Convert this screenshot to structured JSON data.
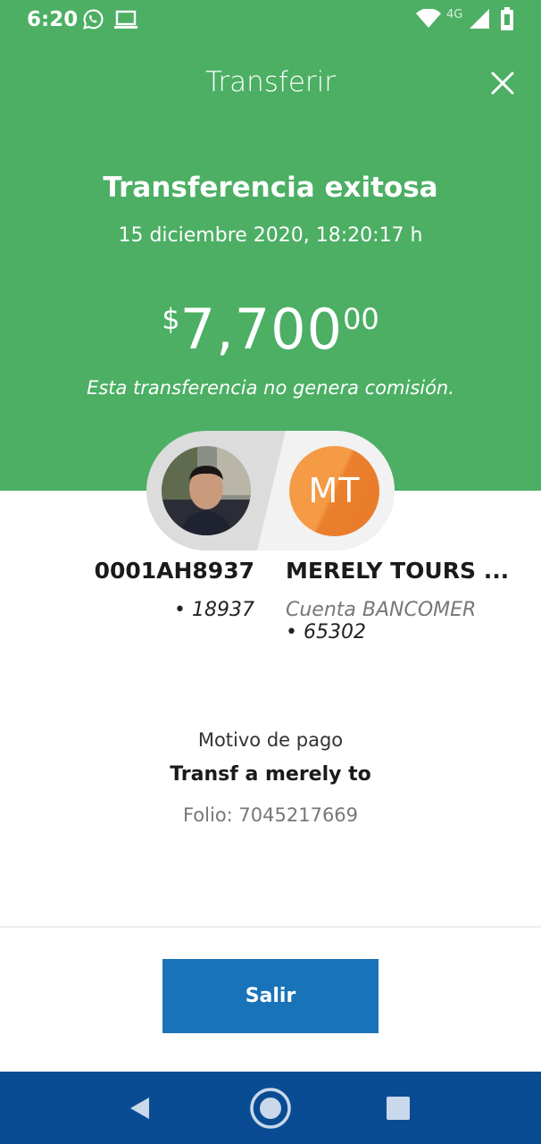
{
  "status_bar": {
    "time": "6:20",
    "network": "4G",
    "icons": [
      "whatsapp-icon",
      "laptop-icon",
      "wifi-icon",
      "signal-icon",
      "battery-icon"
    ]
  },
  "header": {
    "title": "Transferir",
    "close_icon": "close-icon"
  },
  "result": {
    "title": "Transferencia exitosa",
    "datetime": "15 diciembre 2020, 18:20:17 h",
    "amount_currency": "$",
    "amount_integer": "7,700",
    "amount_decimals": "00",
    "commission_note": "Esta transferencia no genera comisión."
  },
  "sender": {
    "account": "0001AH8937",
    "number": "• 18937"
  },
  "recipient": {
    "initials": "MT",
    "name": "MERELY TOURS ...",
    "bank": "Cuenta BANCOMER",
    "number": "• 65302"
  },
  "details": {
    "reason_label": "Motivo de pago",
    "reason_value": "Transf a merely to",
    "folio": "Folio: 7045217669"
  },
  "actions": {
    "exit_label": "Salir"
  },
  "nav_bar": {
    "icons": [
      "back-icon",
      "home-icon",
      "recents-icon"
    ]
  },
  "colors": {
    "header_green": "#4caf64",
    "button_blue": "#1973b8",
    "navbar_blue": "#0a4c94",
    "avatar_orange": "#f59a45"
  }
}
